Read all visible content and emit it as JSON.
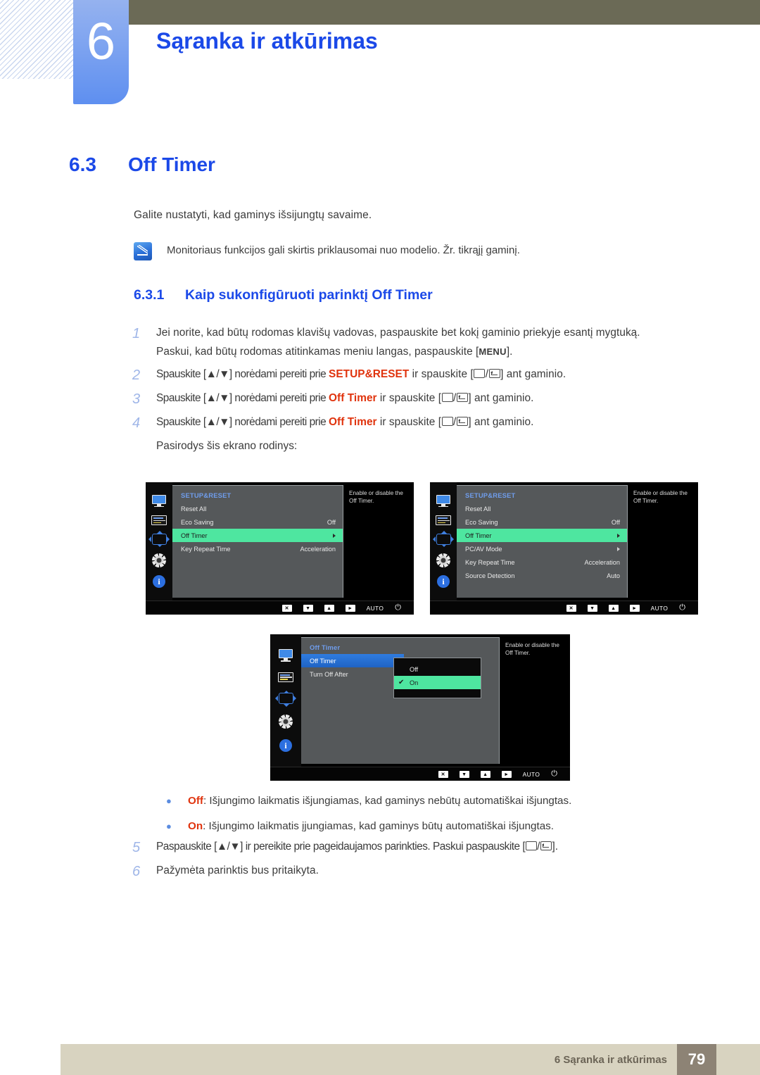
{
  "header": {
    "chapter_number": "6",
    "chapter_title": "Sąranka ir atkūrimas"
  },
  "section": {
    "number": "6.3",
    "title": "Off Timer",
    "intro": "Galite nustatyti, kad gaminys išsijungtų savaime.",
    "note": "Monitoriaus funkcijos gali skirtis priklausomai nuo modelio. Žr. tikrąjį gaminį.",
    "note_icon": "note-pencil-icon"
  },
  "subsection": {
    "number": "6.3.1",
    "title": "Kaip sukonfigūruoti parinktį Off Timer"
  },
  "steps": [
    {
      "num": "1",
      "line1_a": "Jei norite, kad būtų rodomas klavišų vadovas, paspauskite bet kokį gaminio priekyje esantį mygtuką.",
      "line2_a": "Paskui, kad būtų rodomas atitinkamas meniu langas, paspauskite [",
      "line2_key": "MENU",
      "line2_b": "]."
    },
    {
      "num": "2",
      "a": "Spauskite [▲/▼] norėdami pereiti prie ",
      "hl": "SETUP&RESET",
      "b": " ir spauskite [",
      "c": "] ant gaminio."
    },
    {
      "num": "3",
      "a": "Spauskite [▲/▼] norėdami pereiti prie ",
      "hl": "Off Timer",
      "b": " ir spauskite [",
      "c": "] ant gaminio."
    },
    {
      "num": "4",
      "a": "Spauskite [▲/▼] norėdami pereiti prie ",
      "hl": "Off Timer",
      "b": " ir spauskite [",
      "c": "] ant gaminio."
    }
  ],
  "after_step4": "Pasirodys šis ekrano rodinys:",
  "osd1": {
    "title": "SETUP&RESET",
    "help": "Enable or disable the Off Timer.",
    "rows": [
      {
        "label": "Reset All",
        "value": "",
        "arrow": false,
        "selected": false
      },
      {
        "label": "Eco Saving",
        "value": "Off",
        "arrow": false,
        "selected": false
      },
      {
        "label": "Off Timer",
        "value": "",
        "arrow": true,
        "selected": true
      },
      {
        "label": "Key Repeat Time",
        "value": "Acceleration",
        "arrow": false,
        "selected": false
      }
    ],
    "buttons": {
      "close": "✕",
      "down": "▼",
      "up": "▲",
      "right": "►",
      "auto": "AUTO",
      "power": "⏻"
    }
  },
  "osd2": {
    "title": "SETUP&RESET",
    "help": "Enable or disable the Off Timer.",
    "rows": [
      {
        "label": "Reset All",
        "value": "",
        "arrow": false,
        "selected": false
      },
      {
        "label": "Eco Saving",
        "value": "Off",
        "arrow": false,
        "selected": false
      },
      {
        "label": "Off Timer",
        "value": "",
        "arrow": true,
        "selected": true
      },
      {
        "label": "PC/AV Mode",
        "value": "",
        "arrow": true,
        "selected": false
      },
      {
        "label": "Key Repeat Time",
        "value": "Acceleration",
        "arrow": false,
        "selected": false
      },
      {
        "label": "Source Detection",
        "value": "Auto",
        "arrow": false,
        "selected": false
      }
    ],
    "buttons": {
      "close": "✕",
      "down": "▼",
      "up": "▲",
      "right": "►",
      "auto": "AUTO",
      "power": "⏻"
    }
  },
  "osd3": {
    "title": "Off Timer",
    "help": "Enable or disable the Off Timer.",
    "rows": [
      {
        "label": "Off Timer",
        "value": "",
        "arrow": false,
        "selected": true
      },
      {
        "label": "Turn Off After",
        "value": "",
        "arrow": false,
        "selected": false
      }
    ],
    "dropdown": {
      "options": [
        {
          "label": "Off",
          "checked": false
        },
        {
          "label": "On",
          "checked": true
        }
      ],
      "check_glyph": "✔"
    },
    "buttons": {
      "close": "✕",
      "down": "▼",
      "up": "▲",
      "right": "►",
      "auto": "AUTO",
      "power": "⏻"
    }
  },
  "bullets": [
    {
      "term": "Off",
      "text": ": Išjungimo laikmatis išjungiamas, kad gaminys nebūtų automatiškai išjungtas."
    },
    {
      "term": "On",
      "text": ": Išjungimo laikmatis įjungiamas, kad gaminys būtų automatiškai išjungtas."
    }
  ],
  "steps2": [
    {
      "num": "5",
      "a": "Paspauskite [▲/▼] ir pereikite prie pageidaujamos parinkties. Paskui paspauskite [",
      "c": "]."
    },
    {
      "num": "6",
      "plain": "Pažymėta parinktis bus pritaikyta."
    }
  ],
  "footer": {
    "text": "6 Sąranka ir atkūrimas",
    "page": "79"
  }
}
